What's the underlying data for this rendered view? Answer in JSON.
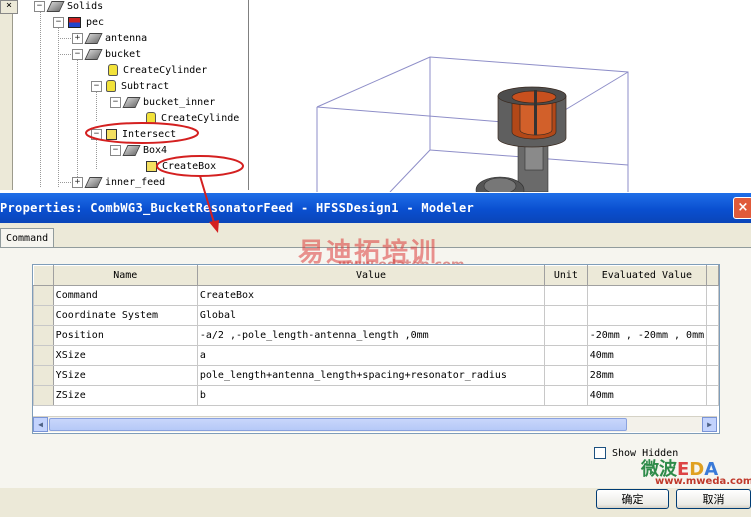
{
  "tree": {
    "close_glyph": "×",
    "items": [
      {
        "label": "Solids",
        "expander": "−",
        "icon": "solid-icon"
      },
      {
        "label": "pec",
        "expander": "−",
        "icon": "material-icon"
      },
      {
        "label": "antenna",
        "expander": "+",
        "icon": "solid-icon"
      },
      {
        "label": "bucket",
        "expander": "−",
        "icon": "solid-icon"
      },
      {
        "label": "CreateCylinder",
        "expander": "",
        "icon": "cylinder-icon"
      },
      {
        "label": "Subtract",
        "expander": "−",
        "icon": "cylinder-icon"
      },
      {
        "label": "bucket_inner",
        "expander": "−",
        "icon": "solid-icon"
      },
      {
        "label": "CreateCylinde",
        "expander": "",
        "icon": "cylinder-icon"
      },
      {
        "label": "Intersect",
        "expander": "−",
        "icon": "intersect-icon"
      },
      {
        "label": "Box4",
        "expander": "−",
        "icon": "solid-icon"
      },
      {
        "label": "CreateBox",
        "expander": "",
        "icon": "box-icon"
      },
      {
        "label": "inner_feed",
        "expander": "+",
        "icon": "solid-icon"
      }
    ]
  },
  "dialog": {
    "title": "Properties: CombWG3_BucketResonatorFeed - HFSSDesign1 - Modeler",
    "close_glyph": "×",
    "tab": "Command",
    "table": {
      "headers": [
        "Name",
        "Value",
        "Unit",
        "Evaluated Value"
      ],
      "rows": [
        {
          "name": "Command",
          "value": "CreateBox",
          "unit": "",
          "evaluated": ""
        },
        {
          "name": "Coordinate System",
          "value": "Global",
          "unit": "",
          "evaluated": ""
        },
        {
          "name": "Position",
          "value": "-a/2 ,-pole_length-antenna_length ,0mm",
          "unit": "",
          "evaluated": "-20mm , -20mm , 0mm"
        },
        {
          "name": "XSize",
          "value": "a",
          "unit": "",
          "evaluated": "40mm"
        },
        {
          "name": "YSize",
          "value": "pole_length+antenna_length+spacing+resonator_radius",
          "unit": "",
          "evaluated": "28mm"
        },
        {
          "name": "ZSize",
          "value": "b",
          "unit": "",
          "evaluated": "40mm"
        }
      ]
    },
    "scroll_left": "◀",
    "scroll_right": "▶",
    "show_hidden_label": "Show Hidden",
    "ok_button": "确定",
    "cancel_button": "取消"
  },
  "watermarks": {
    "cn_brand": "易迪拓培训",
    "cn_url": "www.edatop.com",
    "eda_brand_cn": "微波",
    "eda_brand_en": [
      "E",
      "D",
      "A"
    ],
    "eda_url": "www.mweda.com"
  },
  "colors": {
    "titlebar": "#0a4fd0",
    "annotation": "#d42020",
    "model_orange": "#c8501e",
    "model_gray": "#6a6a6a",
    "dialog_bg": "#ece9d8"
  }
}
